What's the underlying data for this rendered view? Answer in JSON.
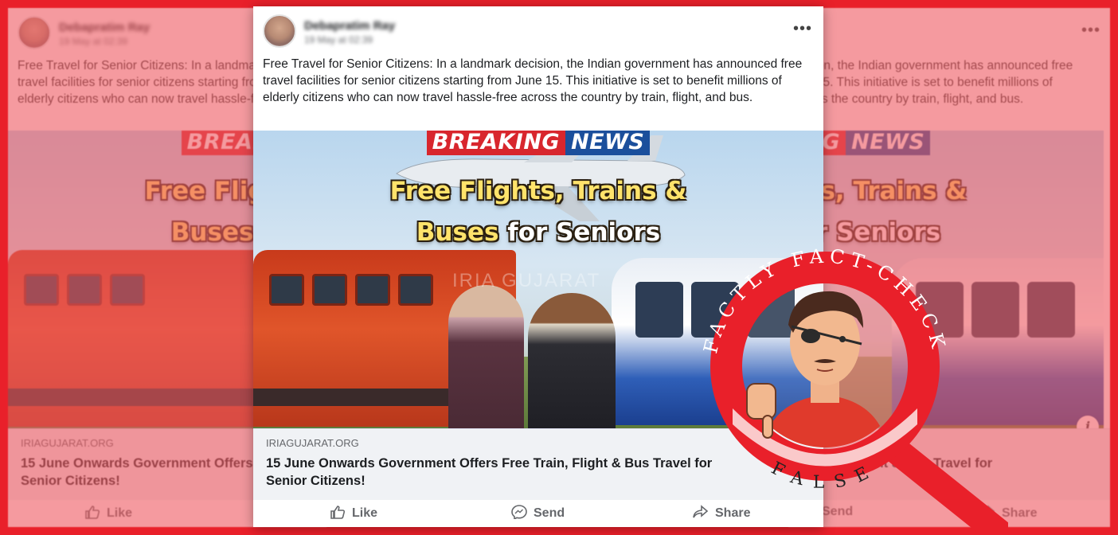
{
  "post": {
    "author": "Debapratim Ray",
    "timestamp": "19 May at 02:39",
    "text": "Free Travel for Senior Citizens: In a landmark decision, the Indian government has announced free travel facilities for senior citizens starting from June 15. This initiative is set to benefit millions of elderly citizens who can now travel hassle-free across the country by train, flight, and bus.",
    "image": {
      "banner_left": "BREAKING",
      "banner_right": "NEWS",
      "line1": "Free Flights, Trains &",
      "line2_yellow": "Buses",
      "line2_white": "for Seniors",
      "watermark": "IRIA GUJARAT"
    },
    "link_domain": "IRIAGUJARAT.ORG",
    "link_title": "15 June Onwards Government Offers Free Train, Flight & Bus Travel for Senior Citizens!",
    "actions": {
      "like": "Like",
      "send": "Send",
      "share": "Share"
    },
    "more_icon": "more-options-icon",
    "info_icon": "info-icon"
  },
  "stamp": {
    "top_text": "FACTLY FACT-CHECK",
    "verdict": "FALSE",
    "ring_color": "#e9202a"
  },
  "colors": {
    "background": "#e9202a",
    "breaking_red": "#d8262d",
    "news_blue": "#1b4f9c",
    "headline_yellow": "#ffe36b"
  }
}
